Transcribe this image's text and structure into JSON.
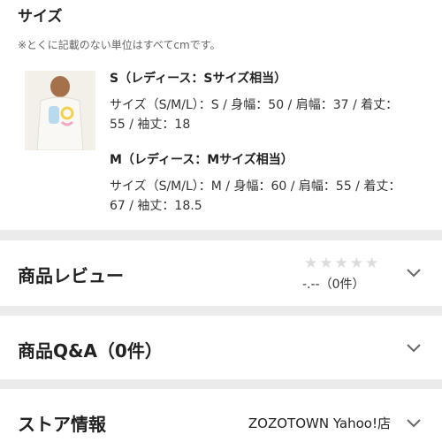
{
  "size_section": {
    "title": "サイズ",
    "note": "※とくに記載のない単位はすべてcmです。",
    "sizes": [
      {
        "head": "S（レディース：Sサイズ相当）",
        "detail": "サイズ（S/M/L）：S / 身幅：50 / 肩幅：37 / 着丈：55 / 袖丈：18"
      },
      {
        "head": "M（レディース：Mサイズ相当）",
        "detail": "サイズ（S/M/L）：M / 身幅：60 / 肩幅：55 / 着丈：67 / 袖丈：18.5"
      }
    ]
  },
  "review": {
    "label": "商品レビュー",
    "stars_filled": 0,
    "stars_total": 5,
    "score_text": "-.--（0件）"
  },
  "qa": {
    "label": "商品Q&A（0件）"
  },
  "store": {
    "label": "ストア情報",
    "name": "ZOZOTOWN Yahoo!店"
  },
  "colors": {
    "page_bg": "#ebebeb",
    "star_empty": "#dcdcdc"
  },
  "icons": {
    "thumbnail": "product-photo",
    "chevron": "chevron-down-icon",
    "star": "star-icon"
  }
}
